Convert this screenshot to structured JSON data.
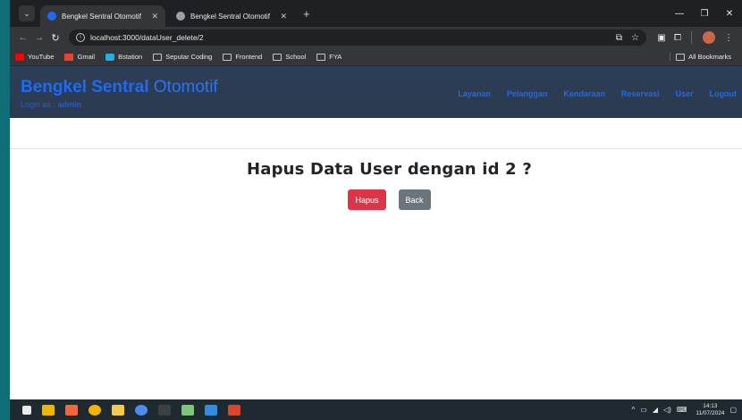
{
  "browser": {
    "tabs": [
      {
        "title": "Bengkel Sentral Otomotif",
        "active": true
      },
      {
        "title": "Bengkel Sentral Otomotif",
        "active": false
      }
    ],
    "url": "localhost:3000/dataUser_delete/2",
    "bookmarks": [
      "YouTube",
      "Gmail",
      "Bstation",
      "Seputar Coding",
      "Frontend",
      "School",
      "FYA"
    ],
    "all_bookmarks": "All Bookmarks"
  },
  "site": {
    "brand_bold": "Bengkel Sentral",
    "brand_thin": "Otomotif",
    "login_prefix": "Login as :",
    "login_user": "admin",
    "nav": [
      "Layanan",
      "Pelanggan",
      "Kendaraan",
      "Reservasi",
      "User",
      "Logout"
    ]
  },
  "page": {
    "heading": "Hapus Data User dengan id 2 ?",
    "delete_label": "Hapus",
    "back_label": "Back"
  },
  "taskbar": {
    "time": "14:13",
    "date": "11/07/2024"
  },
  "colors": {
    "brand": "#1e6af2",
    "danger": "#dc3545",
    "secondary": "#6c757d"
  }
}
